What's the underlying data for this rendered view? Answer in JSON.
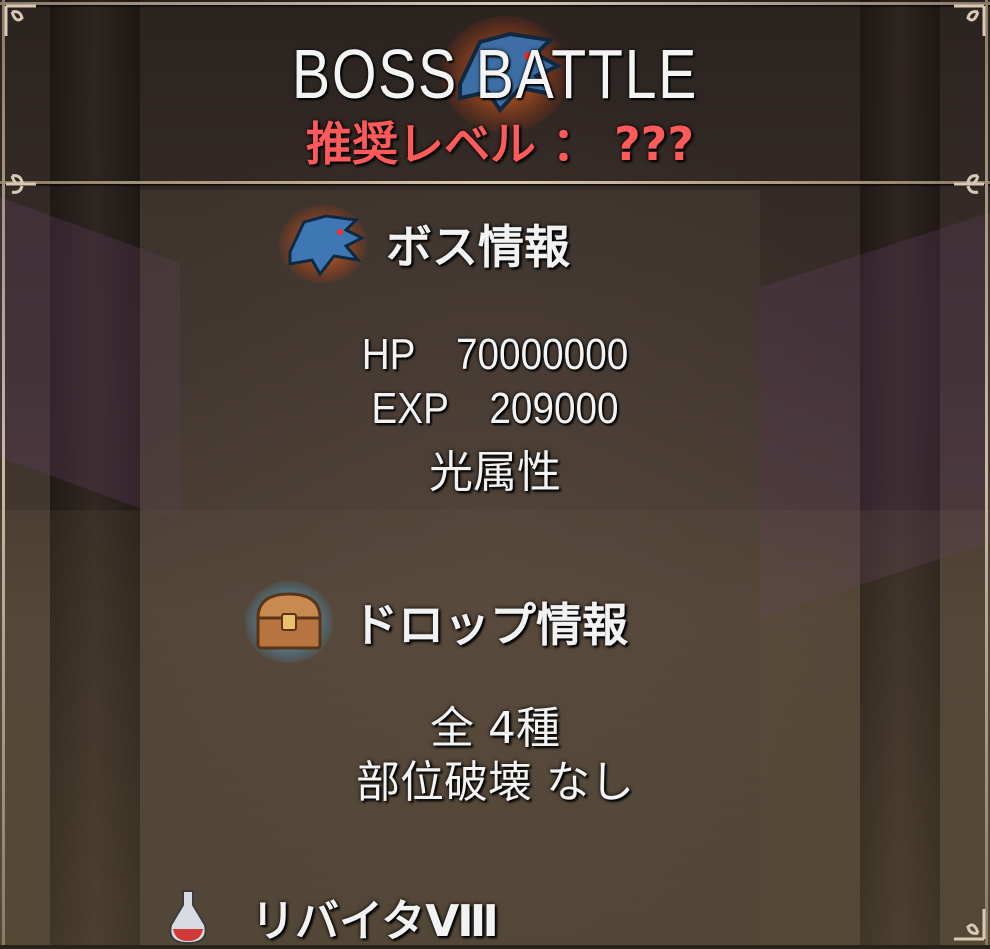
{
  "header": {
    "title": "BOSS BATTLE",
    "recommended_level": "推奨レベル ： ???"
  },
  "boss_info": {
    "heading": "ボス情報",
    "icon": "boss-shark-icon",
    "hp_label": "HP",
    "hp_value": "70000000",
    "exp_label": "EXP",
    "exp_value": "209000",
    "element": "光属性"
  },
  "drop_info": {
    "heading": "ドロップ情報",
    "icon": "treasure-chest-icon",
    "total": "全 4種",
    "part_break": "部位破壊 なし",
    "items": [
      {
        "name": "リバイタⅧ",
        "icon": "potion-icon"
      }
    ]
  },
  "colors": {
    "recommended_level": "#ff5a5a",
    "frame": "#d8c9b4",
    "text": "#f3f3f3"
  }
}
